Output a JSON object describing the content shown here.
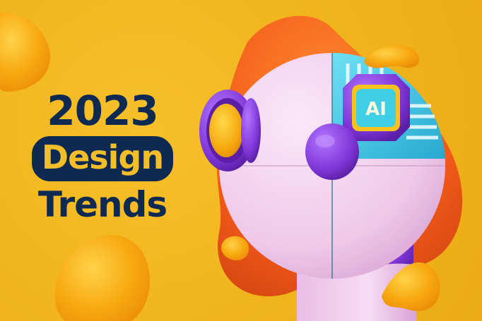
{
  "headline": {
    "year": "2023",
    "word_highlight": "Design",
    "word_last": "Trends"
  },
  "illustration": {
    "chip_label": "AI",
    "colors": {
      "background": "#f2b61d",
      "navy_text": "#0f2a52",
      "orange_blob": "#f56a1c",
      "pink_head": "#f2d3ee",
      "purple_eye": "#8a3fe0",
      "teal_circuit": "#39c2e0",
      "yellow_lens": "#f9b912"
    }
  }
}
